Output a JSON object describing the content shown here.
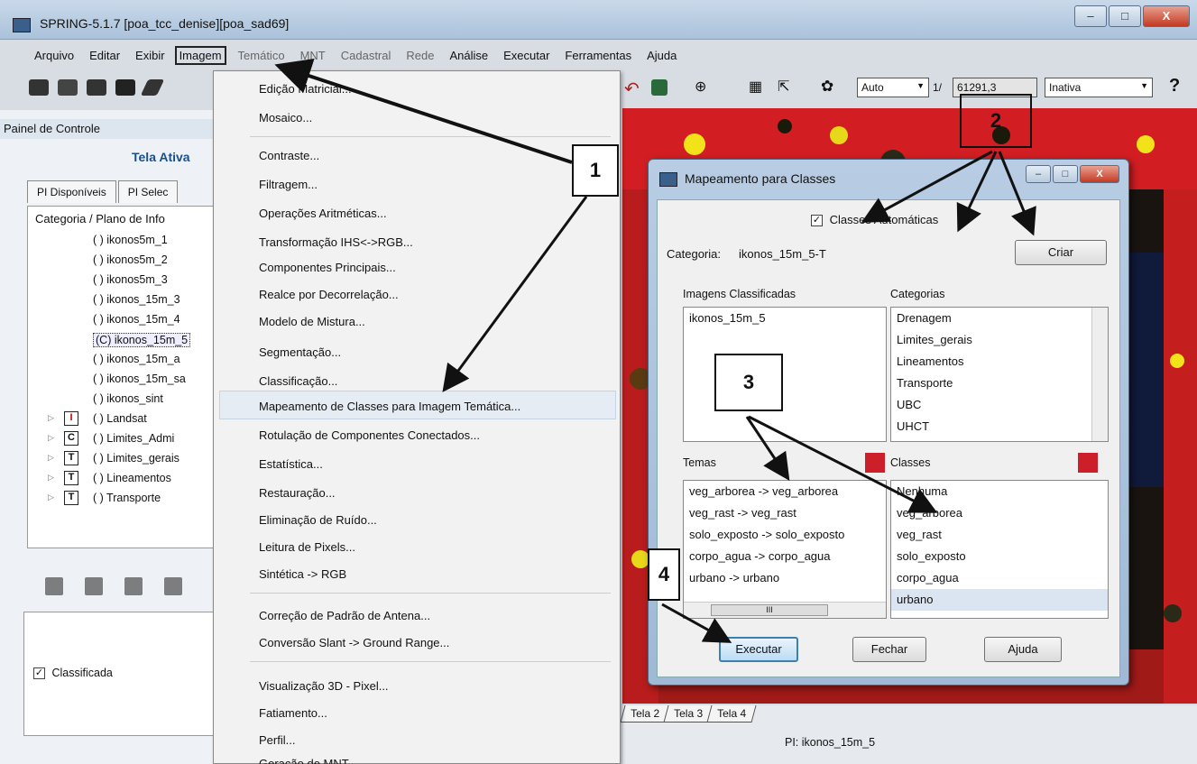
{
  "window": {
    "title": "SPRING-5.1.7 [poa_tcc_denise][poa_sad69]",
    "min_glyph": "–",
    "max_glyph": "□",
    "close_glyph": "X"
  },
  "menubar": {
    "items": [
      {
        "label": "Arquivo",
        "state": "normal"
      },
      {
        "label": "Editar",
        "state": "normal"
      },
      {
        "label": "Exibir",
        "state": "normal"
      },
      {
        "label": "Imagem",
        "state": "active"
      },
      {
        "label": "Temático",
        "state": "dim"
      },
      {
        "label": "MNT",
        "state": "dim"
      },
      {
        "label": "Cadastral",
        "state": "dim"
      },
      {
        "label": "Rede",
        "state": "dim"
      },
      {
        "label": "Análise",
        "state": "normal"
      },
      {
        "label": "Executar",
        "state": "normal"
      },
      {
        "label": "Ferramentas",
        "state": "normal"
      },
      {
        "label": "Ajuda",
        "state": "normal"
      }
    ]
  },
  "toolbar": {
    "zoom_mode": "Auto",
    "scale_prefix": "1/",
    "scale_value": "61291,3",
    "status_combo": "Inativa",
    "help_glyph": "?"
  },
  "left_panel": {
    "title": "Painel de Controle",
    "active_screen": "Tela Ativa",
    "tabs": [
      "PI Disponíveis",
      "PI Selec"
    ],
    "tree_header": "Categoria / Plano de Info",
    "rows": [
      {
        "type": "",
        "label": "( ) ikonos5m_1"
      },
      {
        "type": "",
        "label": "( ) ikonos5m_2"
      },
      {
        "type": "",
        "label": "( ) ikonos5m_3"
      },
      {
        "type": "",
        "label": "( ) ikonos_15m_3"
      },
      {
        "type": "",
        "label": "( ) ikonos_15m_4"
      },
      {
        "type": "",
        "label": "(C) ikonos_15m_5",
        "selected": true
      },
      {
        "type": "",
        "label": "( ) ikonos_15m_a"
      },
      {
        "type": "",
        "label": "( ) ikonos_15m_sa"
      },
      {
        "type": "",
        "label": "( ) ikonos_sint"
      },
      {
        "type": "I",
        "label": "( ) Landsat"
      },
      {
        "type": "C",
        "label": "( ) Limites_Admi"
      },
      {
        "type": "T",
        "label": "( ) Limites_gerais"
      },
      {
        "type": "T",
        "label": "( ) Lineamentos"
      },
      {
        "type": "T",
        "label": "( ) Transporte"
      }
    ],
    "classified_label": "Classificada",
    "classified_checked": "✓"
  },
  "dropdown": {
    "items": [
      "Edição Matricial...",
      "Mosaico...",
      "Contraste...",
      "Filtragem...",
      "Operações Aritméticas...",
      "Transformação IHS<->RGB...",
      "Componentes Principais...",
      "Realce por Decorrelação...",
      "Modelo de Mistura...",
      "Segmentação...",
      "Classificação...",
      "Mapeamento de Classes para Imagem Temática...",
      "Rotulação de Componentes Conectados...",
      "Estatística...",
      "Restauração...",
      "Eliminação de Ruído...",
      "Leitura de Pixels...",
      "Sintética -> RGB",
      "Correção de Padrão de Antena...",
      "Conversão Slant -> Ground Range...",
      "Visualização 3D - Pixel...",
      "Fatiamento...",
      "Perfil...",
      "Geração de MNT..."
    ]
  },
  "canvas": {
    "tabs": [
      "Tela 2",
      "Tela 3",
      "Tela 4"
    ],
    "pi_label": "PI: ikonos_15m_5"
  },
  "dialog": {
    "title": "Mapeamento para Classes",
    "auto_classes_label": "Classes Automáticas",
    "auto_classes_checked": "✓",
    "category_label": "Categoria:",
    "category_value": "ikonos_15m_5-T",
    "create_button": "Criar",
    "classified_images_label": "Imagens Classificadas",
    "classified_images": [
      "ikonos_15m_5"
    ],
    "categories_label": "Categorias",
    "categories": [
      "Drenagem",
      "Limites_gerais",
      "Lineamentos",
      "Transporte",
      "UBC",
      "UHCT"
    ],
    "themes_label": "Temas",
    "themes": [
      "veg_arborea -> veg_arborea",
      "veg_rast -> veg_rast",
      "solo_exposto -> solo_exposto",
      "corpo_agua -> corpo_agua",
      "urbano -> urbano"
    ],
    "classes_label": "Classes",
    "classes": [
      "Nenhuma",
      "veg_arborea",
      "veg_rast",
      "solo_exposto",
      "corpo_agua",
      "urbano"
    ],
    "execute_button": "Executar",
    "close_button": "Fechar",
    "help_button": "Ajuda",
    "color_swatch": "#cc1f2a",
    "scroll_thumb_glyph": "III"
  },
  "callouts": [
    "1",
    "2",
    "3",
    "4"
  ]
}
